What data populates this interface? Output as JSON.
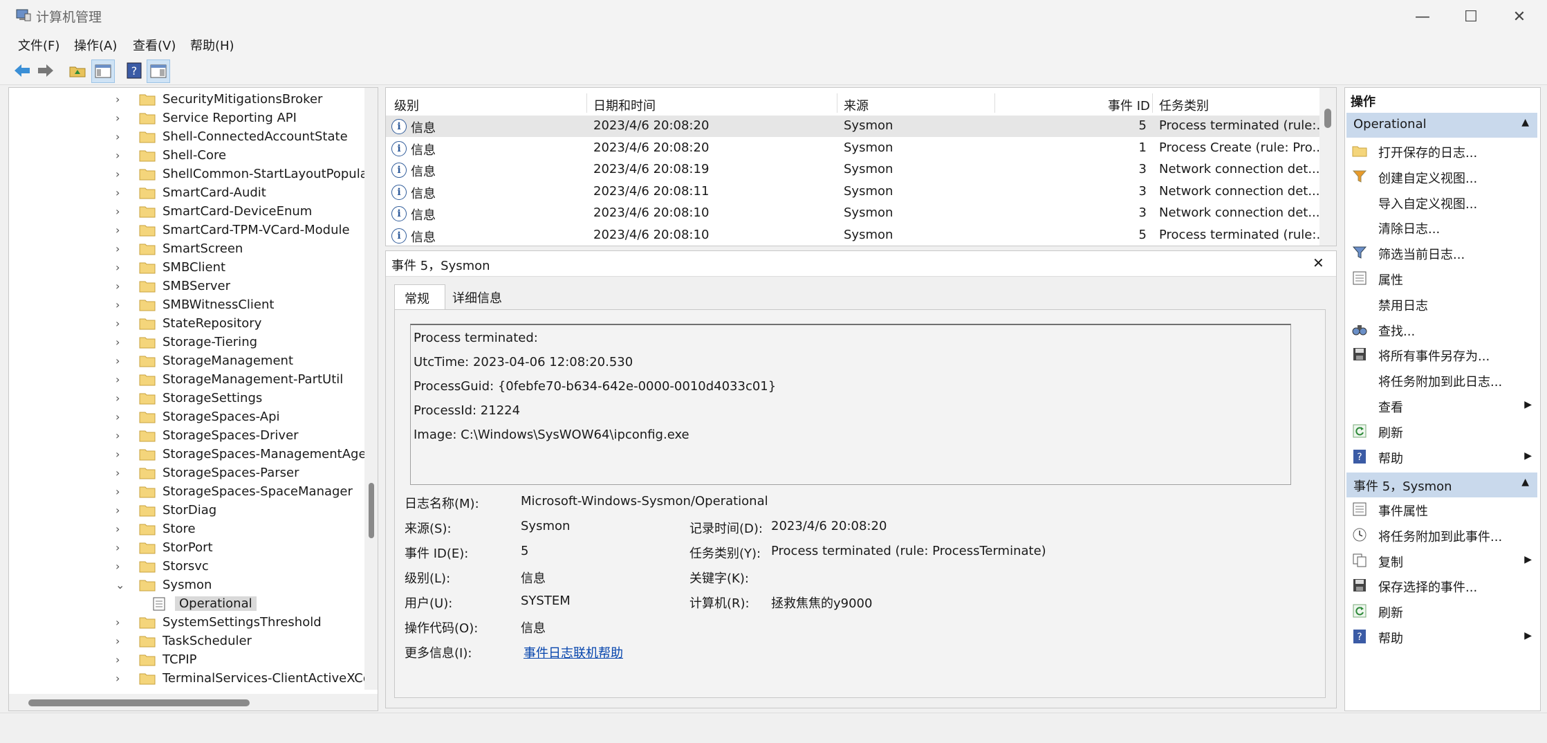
{
  "window": {
    "title": "计算机管理"
  },
  "menu": [
    "文件(F)",
    "操作(A)",
    "查看(V)",
    "帮助(H)"
  ],
  "tree": {
    "items": [
      {
        "label": "SecurityMitigationsBroker",
        "expanded": false
      },
      {
        "label": "Service Reporting API",
        "expanded": false
      },
      {
        "label": "Shell-ConnectedAccountState",
        "expanded": false
      },
      {
        "label": "Shell-Core",
        "expanded": false
      },
      {
        "label": "ShellCommon-StartLayoutPopulation",
        "expanded": false
      },
      {
        "label": "SmartCard-Audit",
        "expanded": false
      },
      {
        "label": "SmartCard-DeviceEnum",
        "expanded": false
      },
      {
        "label": "SmartCard-TPM-VCard-Module",
        "expanded": false
      },
      {
        "label": "SmartScreen",
        "expanded": false
      },
      {
        "label": "SMBClient",
        "expanded": false
      },
      {
        "label": "SMBServer",
        "expanded": false
      },
      {
        "label": "SMBWitnessClient",
        "expanded": false
      },
      {
        "label": "StateRepository",
        "expanded": false
      },
      {
        "label": "Storage-Tiering",
        "expanded": false
      },
      {
        "label": "StorageManagement",
        "expanded": false
      },
      {
        "label": "StorageManagement-PartUtil",
        "expanded": false
      },
      {
        "label": "StorageSettings",
        "expanded": false
      },
      {
        "label": "StorageSpaces-Api",
        "expanded": false
      },
      {
        "label": "StorageSpaces-Driver",
        "expanded": false
      },
      {
        "label": "StorageSpaces-ManagementAgent",
        "expanded": false
      },
      {
        "label": "StorageSpaces-Parser",
        "expanded": false
      },
      {
        "label": "StorageSpaces-SpaceManager",
        "expanded": false
      },
      {
        "label": "StorDiag",
        "expanded": false
      },
      {
        "label": "Store",
        "expanded": false
      },
      {
        "label": "StorPort",
        "expanded": false
      },
      {
        "label": "Storsvc",
        "expanded": false
      },
      {
        "label": "Sysmon",
        "expanded": true
      },
      {
        "label": "Operational",
        "child": true,
        "selected": true
      },
      {
        "label": "SystemSettingsThreshold",
        "expanded": false
      },
      {
        "label": "TaskScheduler",
        "expanded": false
      },
      {
        "label": "TCPIP",
        "expanded": false
      },
      {
        "label": "TerminalServices-ClientActiveXCore",
        "expanded": false
      }
    ]
  },
  "events": {
    "columns": [
      "级别",
      "日期和时间",
      "来源",
      "事件 ID",
      "任务类别"
    ],
    "rows": [
      {
        "level": "信息",
        "datetime": "2023/4/6 20:08:20",
        "source": "Sysmon",
        "id": "5",
        "category": "Process terminated (rule:..."
      },
      {
        "level": "信息",
        "datetime": "2023/4/6 20:08:20",
        "source": "Sysmon",
        "id": "1",
        "category": "Process Create (rule: Pro..."
      },
      {
        "level": "信息",
        "datetime": "2023/4/6 20:08:19",
        "source": "Sysmon",
        "id": "3",
        "category": "Network connection det..."
      },
      {
        "level": "信息",
        "datetime": "2023/4/6 20:08:11",
        "source": "Sysmon",
        "id": "3",
        "category": "Network connection det..."
      },
      {
        "level": "信息",
        "datetime": "2023/4/6 20:08:10",
        "source": "Sysmon",
        "id": "3",
        "category": "Network connection det..."
      },
      {
        "level": "信息",
        "datetime": "2023/4/6 20:08:10",
        "source": "Sysmon",
        "id": "5",
        "category": "Process terminated (rule:..."
      }
    ]
  },
  "detail": {
    "header": "事件 5，Sysmon",
    "close": "✕",
    "tabs": [
      "常规",
      "详细信息"
    ],
    "message": [
      "Process terminated:",
      "UtcTime: 2023-04-06 12:08:20.530",
      "ProcessGuid: {0febfe70-b634-642e-0000-0010d4033c01}",
      "ProcessId: 21224",
      "Image: C:\\Windows\\SysWOW64\\ipconfig.exe"
    ],
    "fields": {
      "log_name_label": "日志名称(M):",
      "log_name": "Microsoft-Windows-Sysmon/Operational",
      "source_label": "来源(S):",
      "source": "Sysmon",
      "logged_label": "记录时间(D):",
      "logged": "2023/4/6 20:08:20",
      "event_id_label": "事件 ID(E):",
      "event_id": "5",
      "task_label": "任务类别(Y):",
      "task": "Process terminated (rule: ProcessTerminate)",
      "level_label": "级别(L):",
      "level": "信息",
      "keywords_label": "关键字(K):",
      "keywords": "",
      "user_label": "用户(U):",
      "user": "SYSTEM",
      "computer_label": "计算机(R):",
      "computer": "拯救焦焦的y9000",
      "opcode_label": "操作代码(O):",
      "opcode": "信息",
      "more_info_label": "更多信息(I):",
      "more_info": "事件日志联机帮助"
    }
  },
  "actions": {
    "title": "操作",
    "section1": "Operational",
    "items1": [
      {
        "label": "打开保存的日志...",
        "icon": "open-folder-icon"
      },
      {
        "label": "创建自定义视图...",
        "icon": "funnel-icon"
      },
      {
        "label": "导入自定义视图...",
        "icon": ""
      },
      {
        "label": "清除日志...",
        "icon": ""
      },
      {
        "label": "筛选当前日志...",
        "icon": "filter-icon"
      },
      {
        "label": "属性",
        "icon": "properties-icon"
      },
      {
        "label": "禁用日志",
        "icon": ""
      },
      {
        "label": "查找...",
        "icon": "binoculars-icon"
      },
      {
        "label": "将所有事件另存为...",
        "icon": "save-icon"
      },
      {
        "label": "将任务附加到此日志...",
        "icon": ""
      },
      {
        "label": "查看",
        "icon": "",
        "submenu": true
      },
      {
        "label": "刷新",
        "icon": "refresh-icon"
      },
      {
        "label": "帮助",
        "icon": "help-icon",
        "submenu": true
      }
    ],
    "section2": "事件 5，Sysmon",
    "items2": [
      {
        "label": "事件属性",
        "icon": "properties-icon"
      },
      {
        "label": "将任务附加到此事件...",
        "icon": "task-icon"
      },
      {
        "label": "复制",
        "icon": "copy-icon",
        "submenu": true
      },
      {
        "label": "保存选择的事件...",
        "icon": "save-icon"
      },
      {
        "label": "刷新",
        "icon": "refresh-icon"
      },
      {
        "label": "帮助",
        "icon": "help-icon",
        "submenu": true
      }
    ]
  }
}
